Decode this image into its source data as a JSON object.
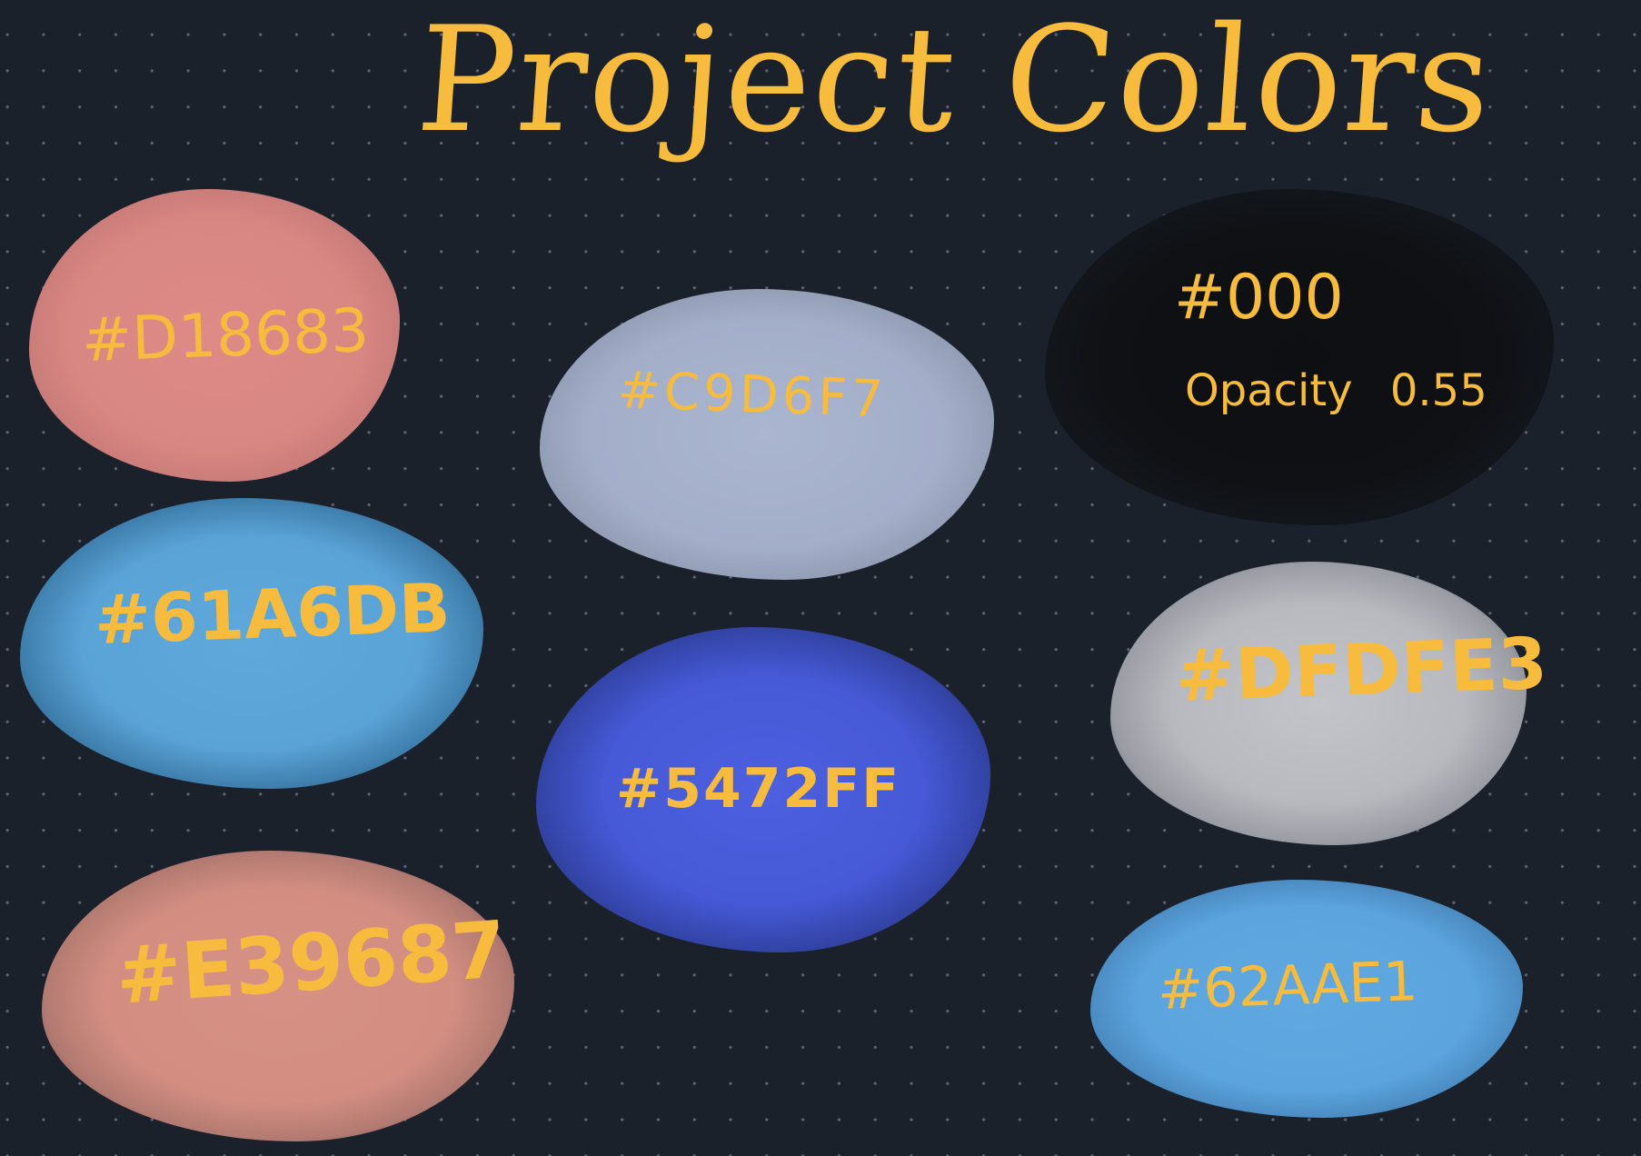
{
  "title": {
    "text": "Project Colors",
    "color": "#f7bb3d"
  },
  "background_color": "#1b212b",
  "label_color": "#f7bb3d",
  "swatches": [
    {
      "id": "d18683",
      "fill": "#d98783",
      "label": "#D18683"
    },
    {
      "id": "c9d6f7",
      "fill": "#a5b0cb",
      "label": "#C9D6F7"
    },
    {
      "id": "000",
      "fill": "#101318",
      "label": "#000",
      "note": "Opacity 0.55"
    },
    {
      "id": "61a6db",
      "fill": "#5aa3d6",
      "label": "#61A6DB"
    },
    {
      "id": "5472ff",
      "fill": "#4659d6",
      "label": "#5472FF"
    },
    {
      "id": "dfdfe3",
      "fill": "#bcbdc3",
      "label": "#DFDFE3"
    },
    {
      "id": "e39687",
      "fill": "#d38e81",
      "label": "#E39687"
    },
    {
      "id": "62aae1",
      "fill": "#5ba4dd",
      "label": "#62AAE1"
    }
  ]
}
